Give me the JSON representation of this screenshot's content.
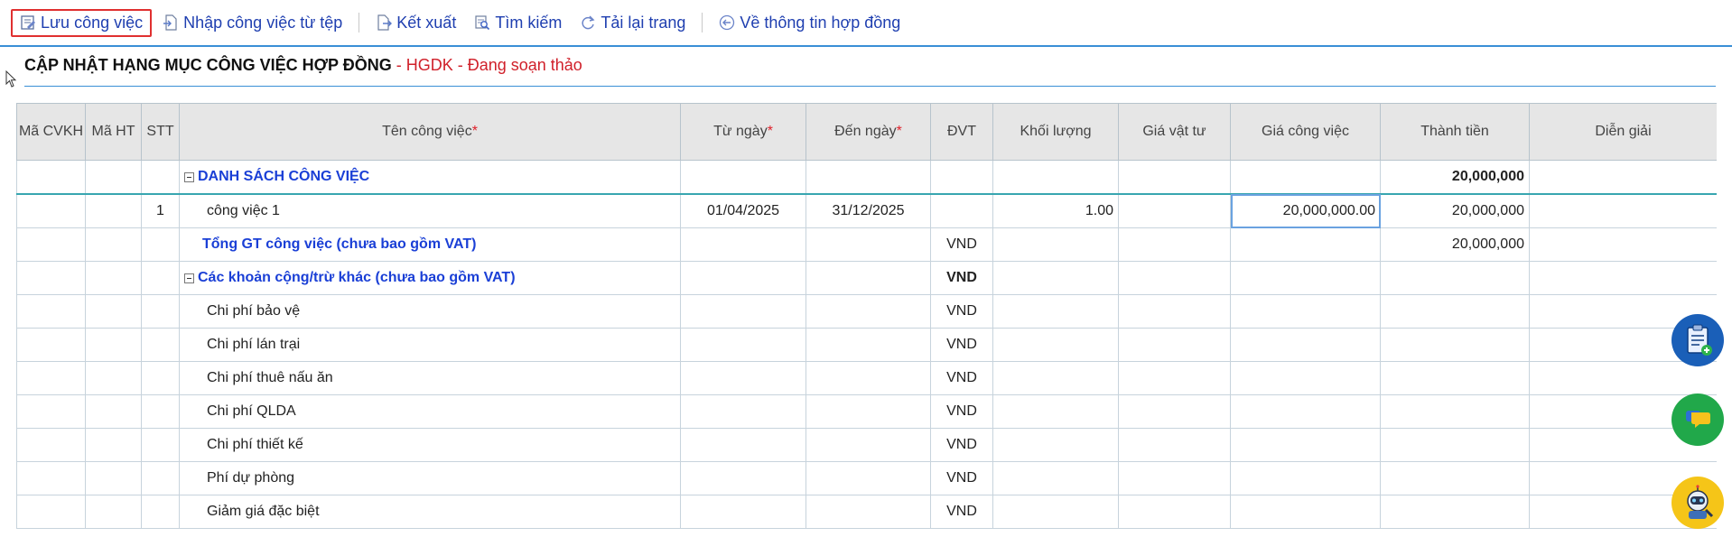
{
  "toolbar": {
    "save": "Lưu công việc",
    "import": "Nhập công việc từ tệp",
    "export": "Kết xuất",
    "search": "Tìm kiếm",
    "reload": "Tải lại trang",
    "back": "Về thông tin hợp đồng"
  },
  "heading": {
    "title": "CẬP NHẬT HẠNG MỤC CÔNG VIỆC HỢP ĐỒNG",
    "status": " - HGDK - Đang soạn thảo"
  },
  "grid": {
    "columns": {
      "ma_cvkh": "Mã CVKH",
      "ma_ht": "Mã HT",
      "stt": "STT",
      "ten": "Tên công việc",
      "tu_ngay": "Từ ngày",
      "den_ngay": "Đến ngày",
      "dvt": "ĐVT",
      "khoi_luong": "Khối lượng",
      "gia_vat_tu": "Giá vật tư",
      "gia_cong_viec": "Giá công việc",
      "thanh_tien": "Thành tiền",
      "dien_giai": "Diễn giải"
    },
    "required_mark": "*",
    "group": {
      "name": "DANH SÁCH CÔNG VIỆC",
      "thanh_tien": "20,000,000"
    },
    "item": {
      "stt": "1",
      "name": "công việc 1",
      "tu_ngay": "01/04/2025",
      "den_ngay": "31/12/2025",
      "khoi_luong": "1.00",
      "gia_cong_viec": "20,000,000.00",
      "thanh_tien": "20,000,000"
    },
    "total": {
      "name": "Tổng GT công việc (chưa bao gồm VAT)",
      "dvt": "VND",
      "thanh_tien": "20,000,000"
    },
    "other_group": {
      "name": "Các khoản cộng/trừ khác (chưa bao gồm VAT)",
      "dvt": "VND"
    },
    "other_items": [
      {
        "name": "Chi phí bảo vệ",
        "dvt": "VND"
      },
      {
        "name": "Chi phí lán trại",
        "dvt": "VND"
      },
      {
        "name": "Chi phí thuê nấu ăn",
        "dvt": "VND"
      },
      {
        "name": "Chi phí QLDA",
        "dvt": "VND"
      },
      {
        "name": "Chi phí thiết kế",
        "dvt": "VND"
      },
      {
        "name": "Phí dự phòng",
        "dvt": "VND"
      },
      {
        "name": "Giảm giá đặc biệt",
        "dvt": "VND"
      }
    ]
  },
  "colors": {
    "toolbar_text": "#1f3fb0",
    "heading_status": "#d0202a",
    "group_text": "#1a3fd6",
    "accent_line": "#3a8fd6"
  },
  "side_buttons": [
    "clipboard-add-icon",
    "chat-icon",
    "robot-support-icon"
  ]
}
